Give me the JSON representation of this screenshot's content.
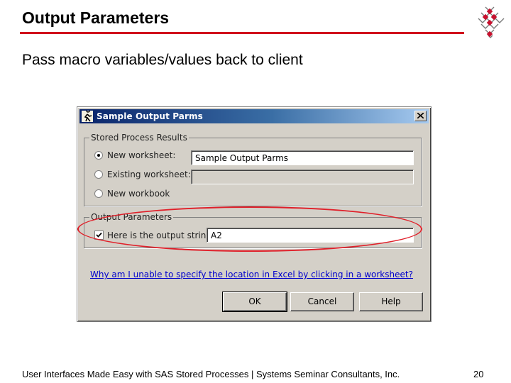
{
  "slide": {
    "title": "Output Parameters",
    "subtitle": "Pass macro variables/values back to client",
    "footer": "User Interfaces Made Easy with SAS Stored Processes  |  Systems Seminar Consultants, Inc.",
    "page_number": "20",
    "accent_color": "#d0101c"
  },
  "dialog": {
    "title": "Sample Output Parms",
    "results_group": {
      "legend": "Stored Process Results",
      "options": [
        {
          "label": "New worksheet:",
          "selected": true,
          "value": "Sample Output Parms"
        },
        {
          "label": "Existing worksheet:",
          "selected": false,
          "value": ""
        },
        {
          "label": "New workbook",
          "selected": false
        }
      ]
    },
    "output_group": {
      "legend": "Output Parameters",
      "checkbox_label": "Here is the output string",
      "checked": true,
      "value": "A2"
    },
    "help_link": "Why am I unable to specify the location in Excel by clicking in a worksheet?",
    "buttons": {
      "ok": "OK",
      "cancel": "Cancel",
      "help": "Help"
    }
  }
}
